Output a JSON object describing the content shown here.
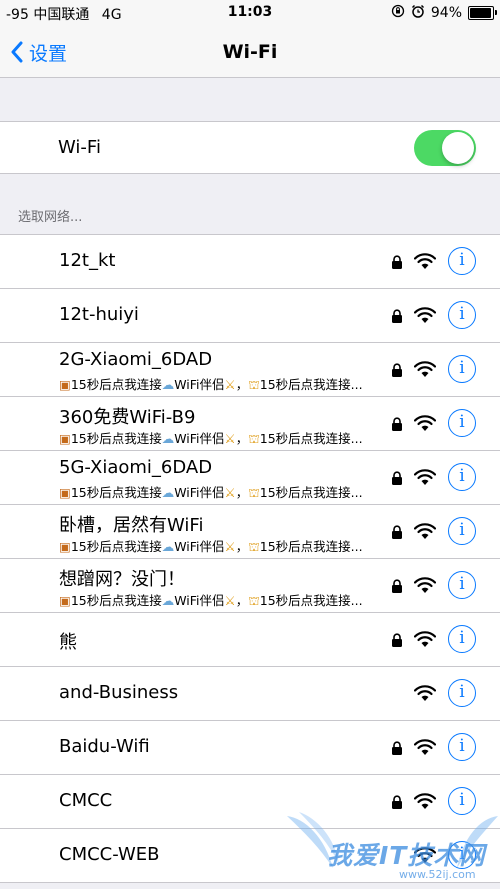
{
  "status_bar": {
    "signal": "-95",
    "carrier": "中国联通",
    "network": "4G",
    "time": "11:03",
    "battery": "94%",
    "battery_level": 0.94,
    "icons": [
      "rotation-lock-icon",
      "alarm-icon"
    ]
  },
  "nav": {
    "back_label": "设置",
    "title": "Wi-Fi"
  },
  "wifi": {
    "label": "Wi-Fi",
    "enabled": true
  },
  "section_header": "选取网络...",
  "sub_text": {
    "part1": "15秒后点我连接",
    "part2": "WiFi伴侣",
    "part3": "，",
    "part4": "15秒后点我连接..."
  },
  "networks": [
    {
      "name": "12t_kt",
      "secured": true,
      "has_sub": false
    },
    {
      "name": "12t-huiyi",
      "secured": true,
      "has_sub": false
    },
    {
      "name": "2G-Xiaomi_6DAD",
      "secured": true,
      "has_sub": true
    },
    {
      "name": "360免费WiFi-B9",
      "secured": true,
      "has_sub": true
    },
    {
      "name": "5G-Xiaomi_6DAD",
      "secured": true,
      "has_sub": true
    },
    {
      "name": "卧槽，居然有WiFi",
      "secured": true,
      "has_sub": true
    },
    {
      "name": "想蹭网？没门！",
      "secured": true,
      "has_sub": true
    },
    {
      "name": "熊",
      "secured": true,
      "has_sub": false
    },
    {
      "name": "and-Business",
      "secured": false,
      "has_sub": false
    },
    {
      "name": "Baidu-Wifi",
      "secured": true,
      "has_sub": false
    },
    {
      "name": "CMCC",
      "secured": true,
      "has_sub": false
    },
    {
      "name": "CMCC-WEB",
      "secured": false,
      "has_sub": false
    }
  ],
  "info_glyph": "i",
  "watermark": {
    "main": "我爱IT技术网",
    "sub": "www.52ij.com"
  },
  "colors": {
    "accent": "#0a7aff",
    "toggle_on": "#4cd964",
    "background": "#efeff4"
  }
}
